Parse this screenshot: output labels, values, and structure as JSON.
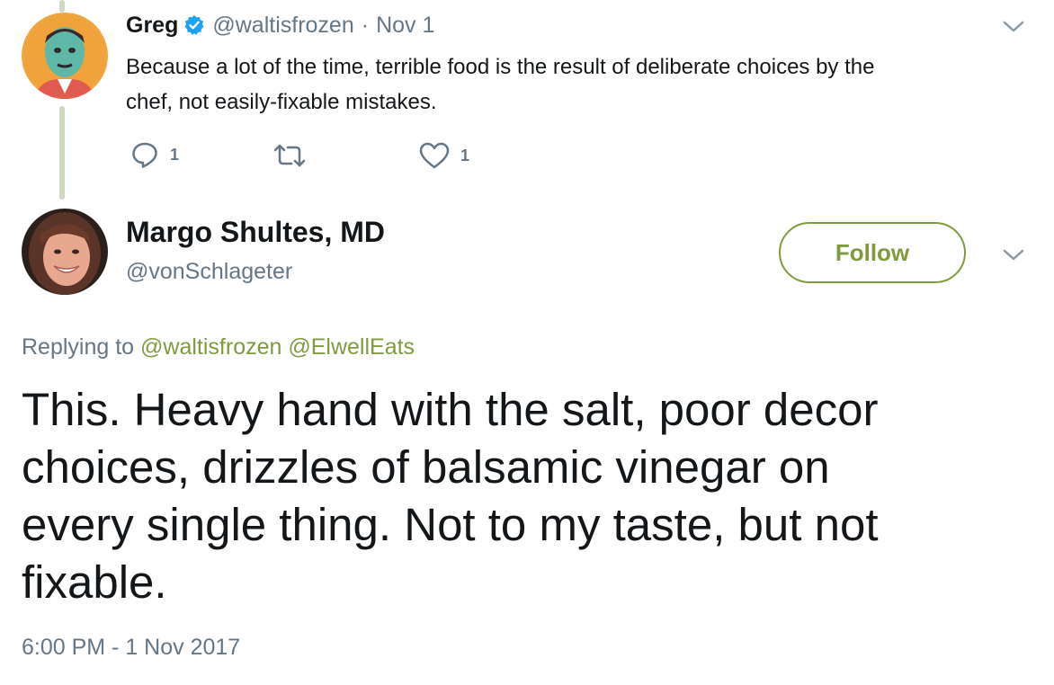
{
  "parent_tweet": {
    "author_name": "Greg",
    "handle": "@waltisfrozen",
    "separator": "·",
    "date": "Nov 1",
    "text_line1": "Because a lot of the time, terrible food is the result of deliberate choices by the",
    "text_line2": "chef, not easily-fixable mistakes.",
    "reply_count": "1",
    "like_count": "1"
  },
  "main_tweet": {
    "author_name": "Margo Shultes, MD",
    "handle": "@vonSchlageter",
    "follow_label": "Follow",
    "replying_prefix": "Replying to",
    "replying_to_1": "@waltisfrozen",
    "replying_to_2": "@ElwellEats",
    "text_line1": "This. Heavy hand with the salt, poor decor",
    "text_line2": "choices, drizzles of balsamic vinegar on",
    "text_line3": "every single thing. Not to my taste, but not",
    "text_line4": "fixable.",
    "timestamp": "6:00 PM - 1 Nov 2017"
  },
  "colors": {
    "accent": "#7f9b3f",
    "verified": "#1da1f2",
    "muted_text": "#657786",
    "thread_line": "#cfd9c2"
  },
  "icons": {
    "verified": "verified-badge-icon",
    "reply": "reply-icon",
    "retweet": "retweet-icon",
    "like": "heart-icon",
    "more": "chevron-down-icon"
  }
}
